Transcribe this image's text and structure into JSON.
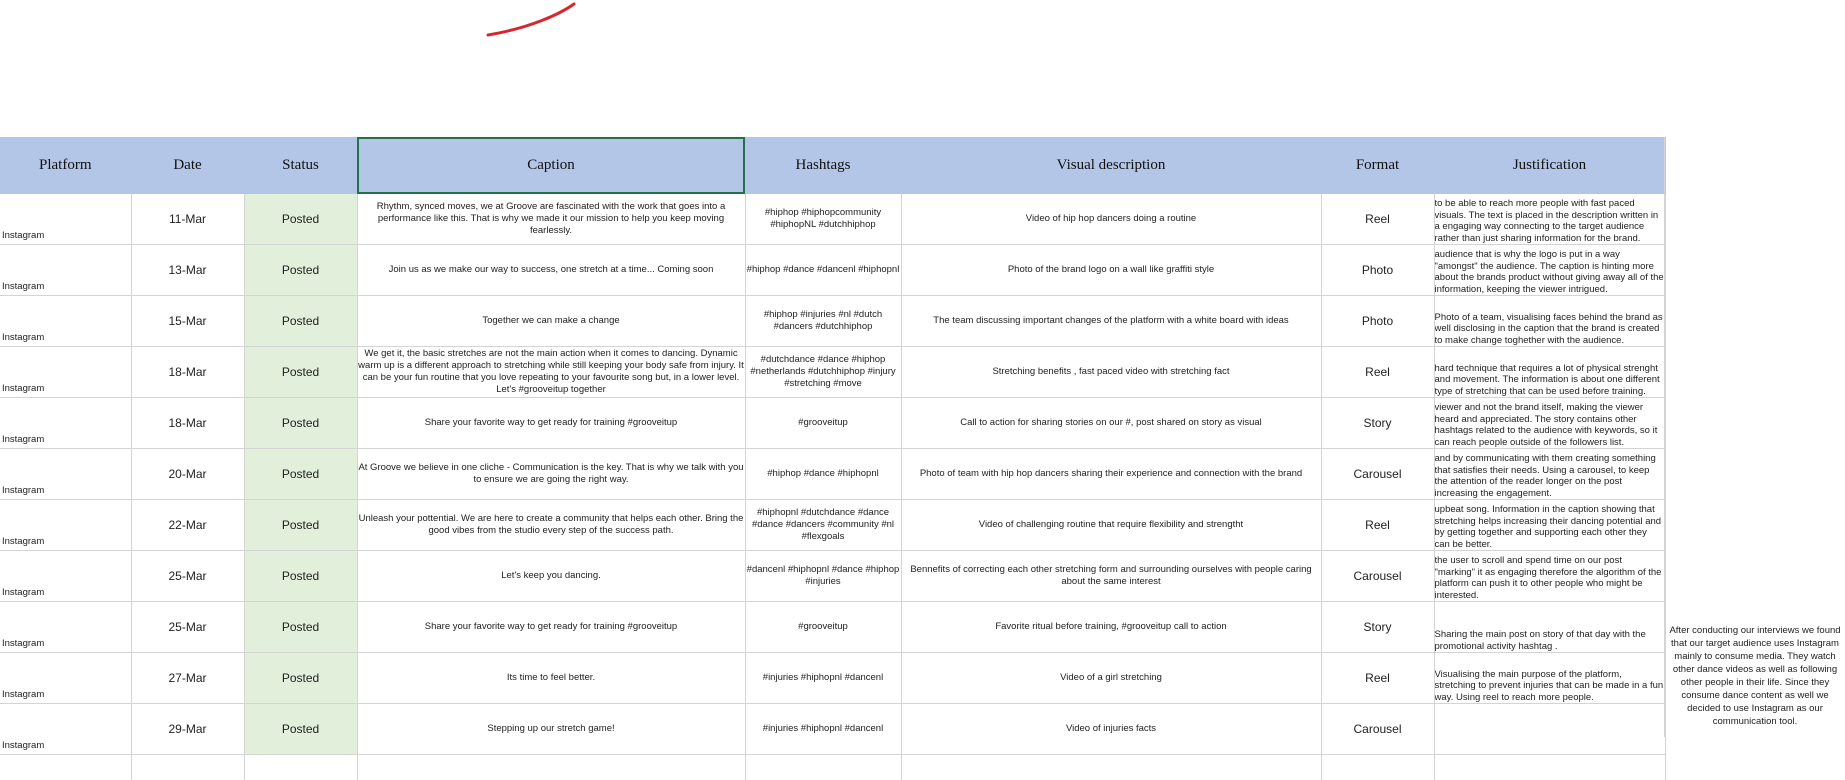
{
  "headers": {
    "platform": "Platform",
    "date": "Date",
    "status": "Status",
    "caption": "Caption",
    "hashtags": "Hashtags",
    "visual": "Visual description",
    "format": "Format",
    "justification": "Justification"
  },
  "rows": [
    {
      "platform": "Instagram",
      "date": "11-Mar",
      "status": "Posted",
      "caption": "Rhythm, synced moves, we at Groove are fascinated with the work that goes into a performance like this. That is why we made it our mission to help you keep moving fearlessly.",
      "hashtags": "#hiphop #hiphopcommunity #hiphopNL #dutchhiphop",
      "visual": "Video of hip hop dancers doing a routine",
      "format": "Reel",
      "justification": "to be able to reach more people with fast paced visuals. The text is placed in the description written in a engaging way connecting to the target audience rather than just sharing information for the brand."
    },
    {
      "platform": "Instagram",
      "date": "13-Mar",
      "status": "Posted",
      "caption": "Join us as we make our way to success, one stretch at a time... Coming soon",
      "hashtags": "#hiphop #dance #dancenl #hiphopnl",
      "visual": "Photo of the brand logo on a wall like graffiti style",
      "format": "Photo",
      "justification": "audience that is why the logo is put in a way \"amongst\" the audience. The caption is hinting more about the brands product without giving away all of the information, keeping the viewer intrigued."
    },
    {
      "platform": "Instagram",
      "date": "15-Mar",
      "status": "Posted",
      "caption": "Together we can make a change",
      "hashtags": "#hiphop #injuries #nl #dutch #dancers #dutchhiphop",
      "visual": "The team discussing important changes of the platform with a white board with ideas",
      "format": "Photo",
      "justification": "Photo of a team, visualising faces behind the brand as well disclosing in the caption that the brand is created to make change toghether with the audience."
    },
    {
      "platform": "Instagram",
      "date": "18-Mar",
      "status": "Posted",
      "caption": "We get it, the basic stretches are not the main action when it comes to dancing. Dynamic warm up is a different approach to stretching while still keeping your body safe from injury. It can be your fun routine that you love repeating to your favourite song but, in a lower level. Let's #grooveitup together",
      "hashtags": "#dutchdance #dance #hiphop #netherlands #dutchhiphop #injury #stretching #move",
      "visual": "Stretching benefits , fast paced video with stretching fact",
      "format": "Reel",
      "justification": "hard technique that requires a lot of physical strenght and movement. The information is about one different type of stretching that can be used before training."
    },
    {
      "platform": "Instagram",
      "date": "18-Mar",
      "status": "Posted",
      "caption": "Share your favorite way to get ready for training #grooveitup",
      "hashtags": "#grooveitup",
      "visual": "Call to action for sharing stories on our #, post shared on story as visual",
      "format": "Story",
      "justification": "viewer and not the brand itself, making the viewer heard and appreciated. The story contains other hashtags related to the audience with keywords, so it can reach people outside of the followers list."
    },
    {
      "platform": "Instagram",
      "date": "20-Mar",
      "status": "Posted",
      "caption": "At Groove we believe in one cliche - Communication is the key. That is why we talk with you to ensure we are going the right way.",
      "hashtags": "#hiphop #dance #hiphopnl",
      "visual": "Photo of team with hip hop dancers sharing their experience and connection with the brand",
      "format": "Carousel",
      "justification": "and by communicating with them creating something that satisfies their needs. Using a carousel, to keep the attention of the reader longer on the post increasing the engagement."
    },
    {
      "platform": "Instagram",
      "date": "22-Mar",
      "status": "Posted",
      "caption": "Unleash your pottential. We are here to create a community that helps each other. Bring the good vibes from the studio every step of the success path.",
      "hashtags": "#hiphopnl #dutchdance #dance #dance #dancers #community #nl #flexgoals",
      "visual": "Video of challenging routine that require flexibility and strengtht",
      "format": "Reel",
      "justification": "upbeat song. Information in the caption showing that stretching helps increasing their dancing potential and by getting together and supporting each other they can be better."
    },
    {
      "platform": "Instagram",
      "date": "25-Mar",
      "status": "Posted",
      "caption": "Let's keep you dancing.",
      "hashtags": "#dancenl #hiphopnl #dance #hiphop #injuries",
      "visual": "Bennefits of correcting each other stretching form and surrounding ourselves with people caring about the same interest",
      "format": "Carousel",
      "justification": "the user to scroll and spend time on our post \"marking\" it as engaging therefore the algorithm of the platform can push it to other people who might be interested."
    },
    {
      "platform": "Instagram",
      "date": "25-Mar",
      "status": "Posted",
      "caption": "Share your favorite way to get ready for training #grooveitup",
      "hashtags": "#grooveitup",
      "visual": "Favorite ritual before training, #grooveitup call to action",
      "format": "Story",
      "justification": "Sharing the main post on story of that day with the promotional activity hashtag ."
    },
    {
      "platform": "Instagram",
      "date": "27-Mar",
      "status": "Posted",
      "caption": "Its time to feel better.",
      "hashtags": "#injuries #hiphopnl #dancenl",
      "visual": "Video of a girl stretching",
      "format": "Reel",
      "justification": "Visualising the main purpose of the platform, stretching to prevent injuries that can be made in a fun way. Using reel to reach more people."
    },
    {
      "platform": "Instagram",
      "date": "29-Mar",
      "status": "Posted",
      "caption": "Stepping up our stretch game!",
      "hashtags": "#injuries #hiphopnl #dancenl",
      "visual": "Video of injuries facts",
      "format": "Carousel",
      "justification": ""
    }
  ],
  "side_note": "After conducting our interviews we found that our target audience uses Instagram mainly to consume media. They watch other dance videos as well as following other people in their life. Since they consume dance content as well we decided to use Instagram as our communication tool."
}
